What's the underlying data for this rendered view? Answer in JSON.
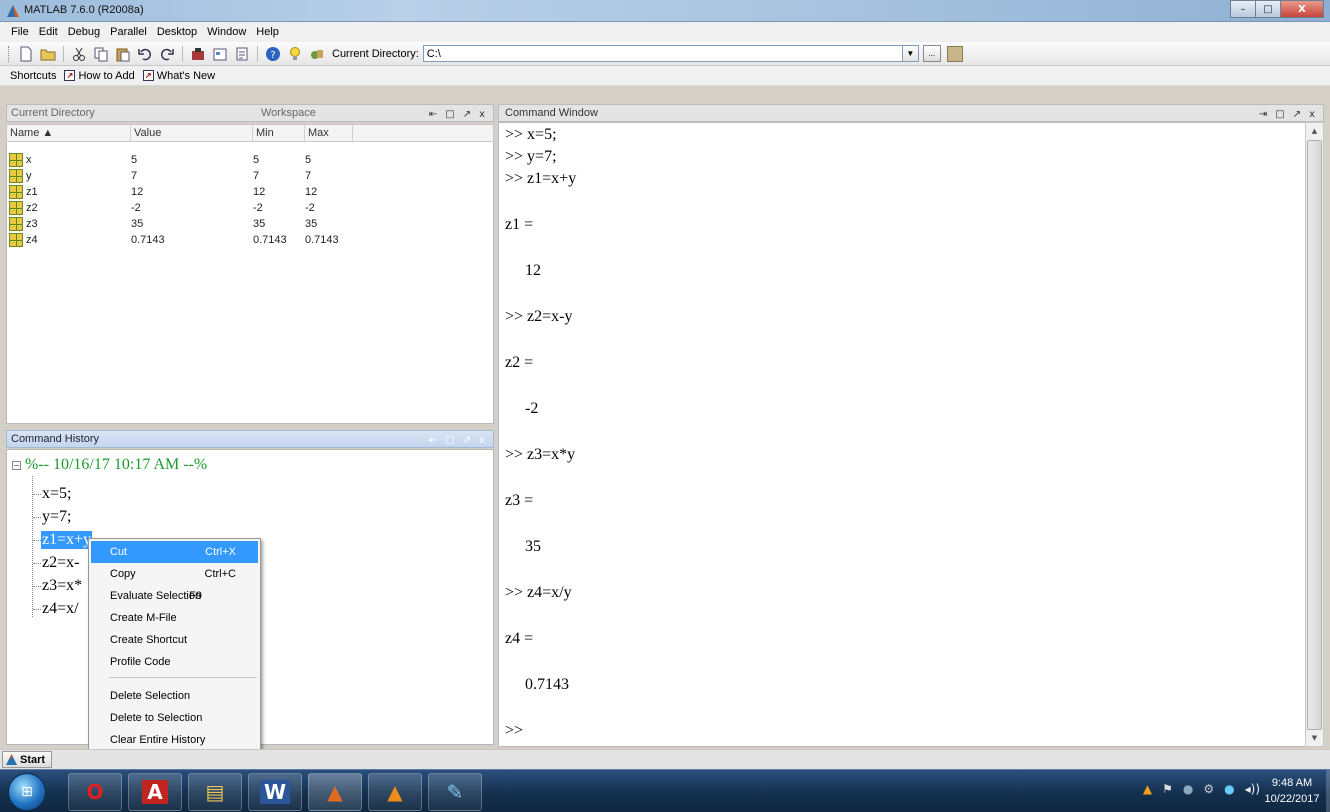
{
  "window": {
    "title": "MATLAB 7.6.0 (R2008a)",
    "min_glyph": "–",
    "max_glyph": "□",
    "close_glyph": "X"
  },
  "menu": [
    "File",
    "Edit",
    "Debug",
    "Parallel",
    "Desktop",
    "Window",
    "Help"
  ],
  "toolbar": {
    "current_directory_label": "Current Directory:",
    "current_directory_value": "C:\\",
    "browse_label": "..."
  },
  "shortcuts": {
    "label": "Shortcuts",
    "items": [
      "How to Add",
      "What's New"
    ]
  },
  "workspace_panel": {
    "tabs": [
      "Current Directory",
      "Workspace"
    ],
    "controls": [
      "⇤",
      "□",
      "↗",
      "x"
    ],
    "columns": [
      "Name ▲",
      "Value",
      "Min",
      "Max"
    ],
    "rows": [
      {
        "name": "x",
        "value": "5",
        "min": "5",
        "max": "5"
      },
      {
        "name": "y",
        "value": "7",
        "min": "7",
        "max": "7"
      },
      {
        "name": "z1",
        "value": "12",
        "min": "12",
        "max": "12"
      },
      {
        "name": "z2",
        "value": "-2",
        "min": "-2",
        "max": "-2"
      },
      {
        "name": "z3",
        "value": "35",
        "min": "35",
        "max": "35"
      },
      {
        "name": "z4",
        "value": "0.7143",
        "min": "0.7143",
        "max": "0.7143"
      }
    ]
  },
  "command_history": {
    "title": "Command History",
    "session": "%-- 10/16/17 10:17 AM --%",
    "entries": [
      "x=5;",
      "y=7;",
      "z1=x+y",
      "z2=x-",
      "z3=x*",
      "z4=x/"
    ],
    "selected_index": 2
  },
  "context_menu": {
    "items": [
      {
        "label": "Cut",
        "shortcut": "Ctrl+X"
      },
      {
        "label": "Copy",
        "shortcut": "Ctrl+C"
      },
      {
        "label": "Evaluate Selection",
        "shortcut": "F9"
      },
      {
        "label": "Create M-File",
        "shortcut": ""
      },
      {
        "label": "Create Shortcut",
        "shortcut": ""
      },
      {
        "label": "Profile Code",
        "shortcut": ""
      },
      {
        "label": "Delete Selection",
        "shortcut": ""
      },
      {
        "label": "Delete to Selection",
        "shortcut": ""
      },
      {
        "label": "Clear Entire History",
        "shortcut": ""
      }
    ],
    "highlighted": "Cut"
  },
  "command_window": {
    "title": "Command Window",
    "controls": [
      "⇥",
      "□",
      "↗",
      "x"
    ],
    "lines": [
      {
        "text": ">> x=5;",
        "kind": "cmd"
      },
      {
        "text": ">> y=7;",
        "kind": "cmd"
      },
      {
        "text": ">> z1=x+y",
        "kind": "cmd"
      },
      {
        "text": "z1 =",
        "kind": "cmd"
      },
      {
        "text": "12",
        "kind": "out"
      },
      {
        "text": ">> z2=x-y",
        "kind": "cmd"
      },
      {
        "text": "z2 =",
        "kind": "cmd"
      },
      {
        "text": "-2",
        "kind": "out"
      },
      {
        "text": ">> z3=x*y",
        "kind": "cmd"
      },
      {
        "text": "z3 =",
        "kind": "cmd"
      },
      {
        "text": "35",
        "kind": "out"
      },
      {
        "text": ">> z4=x/y",
        "kind": "cmd"
      },
      {
        "text": "z4 =",
        "kind": "cmd"
      },
      {
        "text": "0.7143",
        "kind": "out"
      },
      {
        "text": ">>",
        "kind": "cmd"
      }
    ]
  },
  "start_button": "Start",
  "taskbar": {
    "apps": [
      "opera",
      "acrobat",
      "file-explorer",
      "word",
      "matlab",
      "vlc",
      "paint"
    ],
    "app_glyphs": [
      "O",
      "A",
      "▤",
      "W",
      "▲",
      "▲",
      "✎"
    ],
    "tray_glyphs": [
      "▲",
      "⚑",
      "●",
      "⚙",
      "●",
      "◂))"
    ],
    "time": "9:48 AM",
    "date": "10/22/2017"
  },
  "colors": {
    "selection": "#3399ff",
    "history_session": "#1a9a2a",
    "taskbar": "#14304f"
  }
}
